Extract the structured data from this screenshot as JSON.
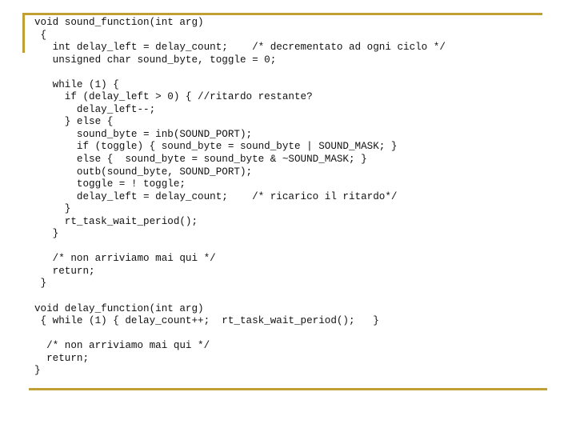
{
  "code_lines": [
    "void sound_function(int arg)",
    " {",
    "   int delay_left = delay_count;    /* decrementato ad ogni ciclo */",
    "   unsigned char sound_byte, toggle = 0;",
    "",
    "   while (1) {",
    "     if (delay_left > 0) { //ritardo restante?",
    "       delay_left--;",
    "     } else {",
    "       sound_byte = inb(SOUND_PORT);",
    "       if (toggle) { sound_byte = sound_byte | SOUND_MASK; }",
    "       else {  sound_byte = sound_byte & ~SOUND_MASK; }",
    "       outb(sound_byte, SOUND_PORT);",
    "       toggle = ! toggle;",
    "       delay_left = delay_count;    /* ricarico il ritardo*/",
    "     }",
    "     rt_task_wait_period();",
    "   }",
    "",
    "   /* non arriviamo mai qui */",
    "   return;",
    " }",
    "",
    "void delay_function(int arg)",
    " { while (1) { delay_count++;  rt_task_wait_period();   }",
    "",
    "  /* non arriviamo mai qui */",
    "  return;",
    "}"
  ],
  "accent_color": "#c0a034"
}
